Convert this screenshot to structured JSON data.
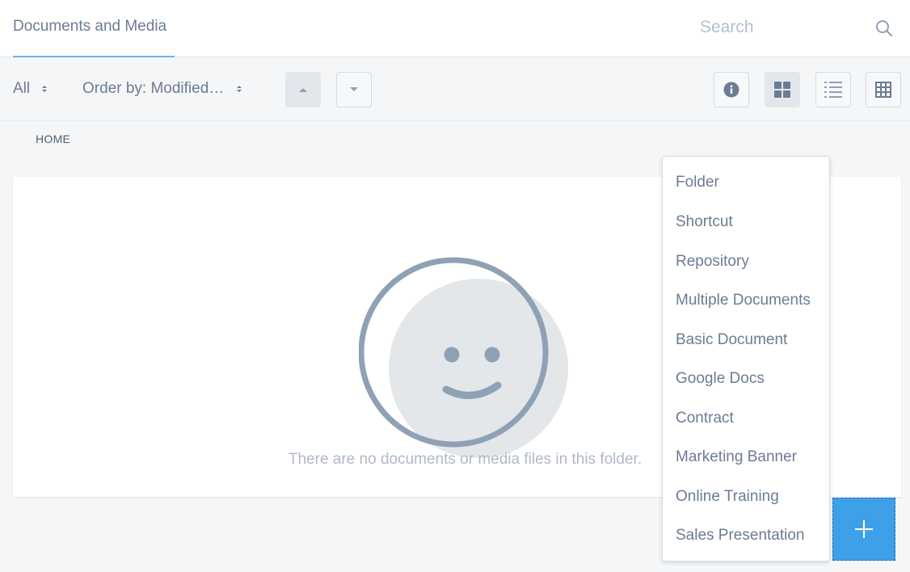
{
  "header": {
    "title": "Documents and Media",
    "search_placeholder": "Search",
    "search_icon": "search-icon"
  },
  "toolbar": {
    "filter_label": "All",
    "order_label": "Order by: Modified…",
    "sort_asc_icon": "caret-up-icon",
    "sort_desc_icon": "caret-down-icon",
    "info_icon": "info-icon",
    "view_cards_icon": "cards-view-icon",
    "view_list_icon": "list-view-icon",
    "view_table_icon": "table-view-icon",
    "active_view": "cards"
  },
  "breadcrumb": {
    "home": "HOME"
  },
  "empty_state": {
    "icon": "smiley-face-icon",
    "message": "There are no documents or media files in this folder."
  },
  "add_menu": {
    "items": [
      "Folder",
      "Shortcut",
      "Repository",
      "Multiple Documents",
      "Basic Document",
      "Google Docs",
      "Contract",
      "Marketing Banner",
      "Online Training",
      "Sales Presentation"
    ]
  },
  "fab": {
    "icon": "plus-icon"
  },
  "colors": {
    "accent": "#3fa0ea",
    "tab_underline": "#65b6e8",
    "text": "#6b7c93",
    "muted_text": "#b0bac5",
    "icon": "#8fa1b4",
    "background": "#f4f6f8"
  }
}
